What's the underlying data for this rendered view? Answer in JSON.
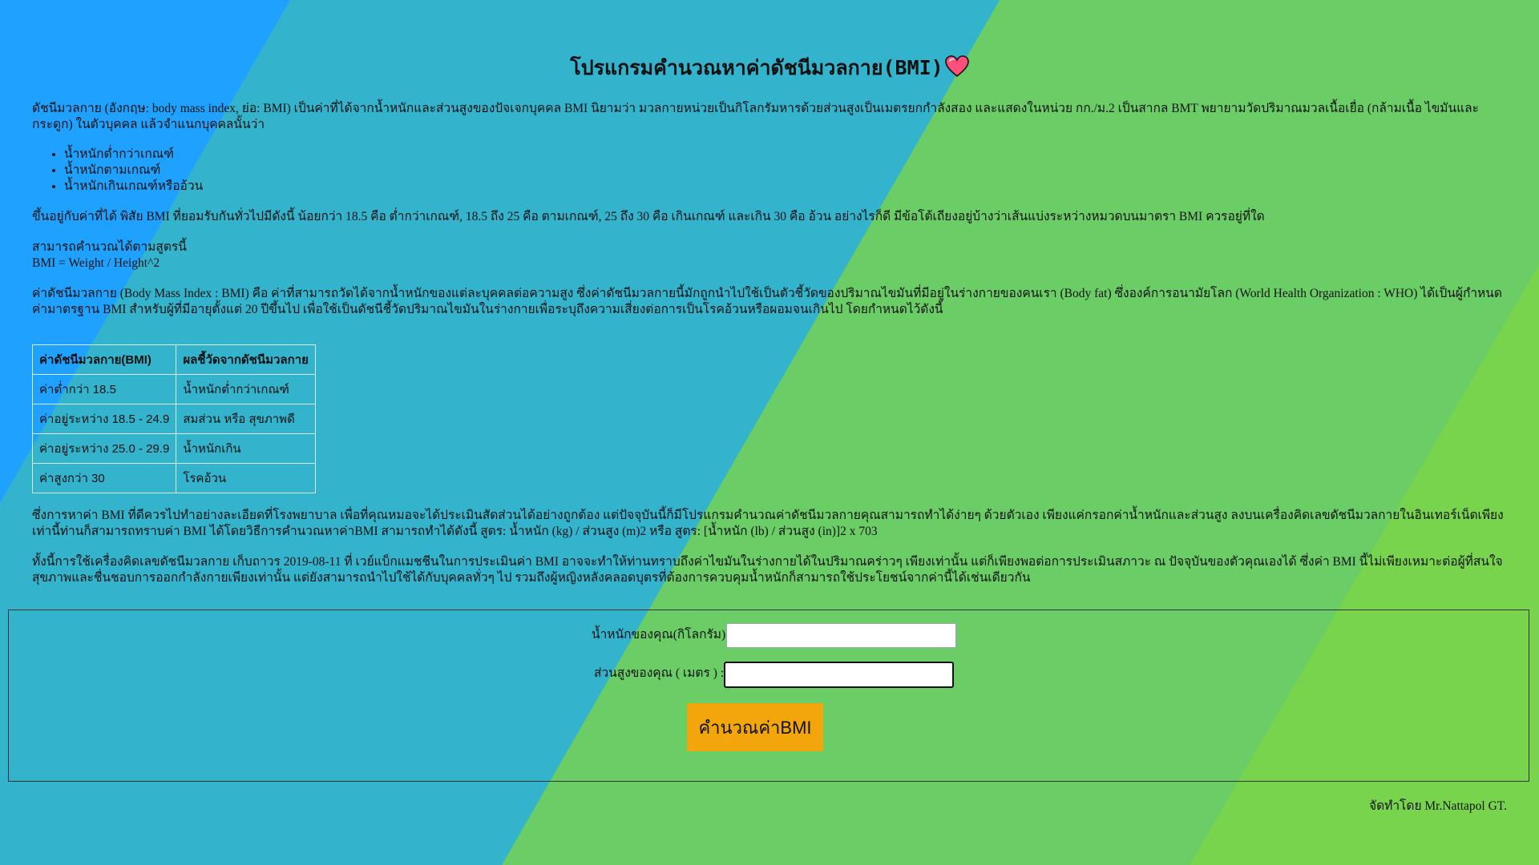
{
  "colors": {
    "blue": "#1fa2ff",
    "teal": "#34b3cd",
    "green": "#6acd66",
    "lime": "#78d44c",
    "button": "#f2a60c"
  },
  "title": "โปรแกรมคำนวณหาค่าดัชนีมวลกาย(BMI)",
  "title_icon": "heart-icon",
  "intro": "ดัชนีมวลกาย (อังกฤษ: body mass index, ย่อ: BMI) เป็นค่าที่ได้จากน้ำหนักและส่วนสูงของปัจเจกบุคคล BMI นิยามว่า มวลกายหน่วยเป็นกิโลกรัมหารด้วยส่วนสูงเป็นเมตรยกกำลังสอง และแสดงในหน่วย กก./ม.2 เป็นสากล BMT พยายามวัดปริมาณมวลเนื้อเยื่อ (กล้ามเนื้อ ไขมันและกระดูก) ในตัวบุคคล แล้วจำแนกบุคคลนั้นว่า",
  "categories": [
    "น้ำหนักต่ำกว่าเกณฑ์",
    "น้ำหนักตามเกณฑ์",
    "น้ำหนักเกินเกณฑ์หรืออ้วน"
  ],
  "ranges_text": "ขึ้นอยู่กับค่าที่ได้ พิสัย BMI ที่ยอมรับกันทั่วไปมีดังนี้ น้อยกว่า 18.5 คือ ต่ำกว่าเกณฑ์, 18.5 ถึง 25 คือ ตามเกณฑ์, 25 ถึง 30 คือ เกินเกณฑ์ และเกิน 30 คือ อ้วน อย่างไรก็ดี มีข้อโต้เถียงอยู่บ้างว่าเส้นแบ่งระหว่างหมวดบนมาตรา BMI ควรอยู่ที่ใด",
  "formula_intro": "สามารถคำนวณได้ตามสูตรนี้",
  "formula": "BMI = Weight / Height^2",
  "definition": "ค่าดัชนีมวลกาย (Body Mass Index : BMI) คือ ค่าที่สามารถวัดได้จากน้ำหนักของแต่ละบุคคลต่อความสูง ซึ่งค่าดัชนีมวลกายนี้มักถูกนำไปใช้เป็นตัวชี้วัดของปริมาณไขมันที่มีอยู่ในร่างกายของคนเรา (Body fat) ซึ่งองค์การอนามัยโลก (World Health Organization : WHO) ได้เป็นผู้กำหนดค่ามาตรฐาน BMI สำหรับผู้ที่มีอายุตั้งแต่ 20 ปีขึ้นไป เพื่อใช้เป็นดัชนีชี้วัดปริมาณไขมันในร่างกายเพื่อระบุถึงความเสี่ยงต่อการเป็นโรคอ้วนหรือผอมจนเกินไป โดยกำหนดไว้ดังนี้",
  "table": {
    "headers": [
      "ค่าดัชนีมวลกาย(BMI)",
      "ผลชี้วัดจากดัชนีมวลกาย"
    ],
    "rows": [
      [
        "ค่าต่ำกว่า 18.5",
        "น้ำหนักต่ำกว่าเกณฑ์"
      ],
      [
        "ค่าอยู่ระหว่าง 18.5 - 24.9",
        "สมส่วน หรือ สุขภาพดี"
      ],
      [
        "ค่าอยู่ระหว่าง 25.0 - 29.9",
        "น้ำหนักเกิน"
      ],
      [
        "ค่าสูงกว่า 30",
        "โรคอ้วน"
      ]
    ]
  },
  "note1": "ซึ่งการหาค่า BMI ที่ดีควรไปทำอย่างละเอียดที่โรงพยาบาล เพื่อที่คุณหมอจะได้ประเมินสัดส่วนได้อย่างถูกต้อง แต่ปัจจุบันนี้ก็มีโปรแกรมคำนวณค่าดัชนีมวลกายคุณสามารถทำได้ง่ายๆ ด้วยตัวเอง เพียงแค่กรอกค่าน้ำหนักและส่วนสูง ลงบนเครื่องคิดเลขดัชนีมวลกายในอินเทอร์เน็ตเพียงเท่านี้ท่านก็สามารถทราบค่า BMI ได้โดยวิธีการคำนวณหาค่าBMI สามารถทำได้ดังนี้ สูตร: น้ำหนัก (kg) / ส่วนสูง (m)2 หรือ สูตร: [น้ำหนัก (lb) / ส่วนสูง (in)]2 x 703",
  "note2": "ทั้งนี้การใช้เครื่องคิดเลขดัชนีมวลกาย เก็บถาวร 2019-08-11 ที่ เวย์แบ็กแมชชีนในการประเมินค่า BMI อาจจะทำให้ท่านทราบถึงค่าไขมันในร่างกายได้ในปริมาณคร่าวๆ เพียงเท่านั้น แต่ก็เพียงพอต่อการประเมินสภาวะ ณ ปัจจุบันของตัวคุณเองได้ ซึ่งค่า BMI นี้ไม่เพียงเหมาะต่อผู้ที่สนใจสุขภาพและชื่นชอบการออกกำลังกายเพียงเท่านั้น แต่ยังสามารถนำไปใช้ได้กับบุคคลทั่วๆ ไป รวมถึงผู้หญิงหลังคลอดบุตรที่ต้องการควบคุมน้ำหนักก็สามารถใช้ประโยชน์จากค่านี้ได้เช่นเดียวกัน",
  "form": {
    "weight_label": "น้ำหนักของคุณ(กิโลกรัม):",
    "weight_value": "",
    "height_label": "ส่วนสูงของคุณ ( เมตร ) :",
    "height_value": "",
    "button_label": "คำนวณค่าBMI"
  },
  "credit": "จัดทำโดย Mr.Nattapol GT."
}
